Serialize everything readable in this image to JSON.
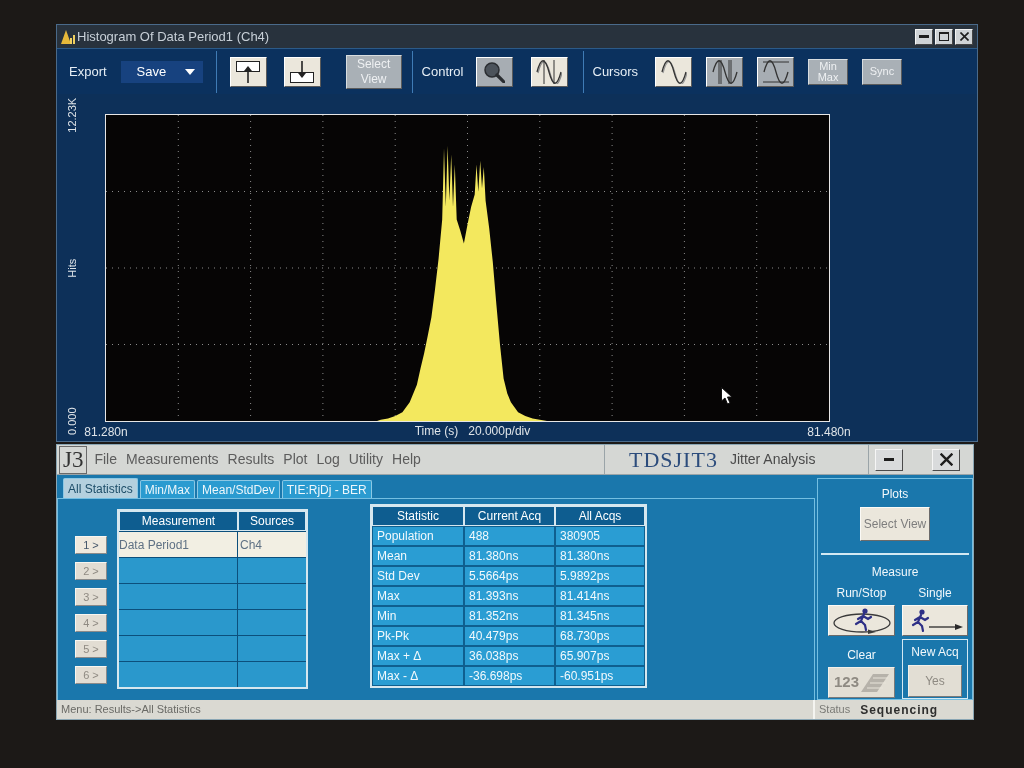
{
  "histogram_window": {
    "title": "Histogram Of Data Period1 (Ch4)",
    "toolbar": {
      "export": {
        "label": "Export",
        "dropdown": {
          "value": "Save"
        }
      },
      "file_buttons": [
        {
          "kind": "export"
        },
        {
          "kind": "import"
        }
      ],
      "select_view": {
        "label": "Select View",
        "disabled": true
      },
      "control": {
        "label": "Control",
        "buttons": [
          {
            "kind": "zoom",
            "pressed": true
          },
          {
            "kind": "waveform",
            "pressed": false
          }
        ]
      },
      "cursors": {
        "label": "Cursors",
        "buttons": [
          {
            "kind": "sine",
            "pressed": false
          },
          {
            "kind": "vertical",
            "pressed": true
          },
          {
            "kind": "horizontal",
            "pressed": true
          },
          {
            "kind": "text",
            "label": "Min Max",
            "disabled": true
          },
          {
            "kind": "text",
            "label": "Sync",
            "disabled": true
          }
        ]
      }
    },
    "chart": {
      "scale": "20.000p/div",
      "chart_data": {
        "type": "area",
        "xlabel": "Time (s)",
        "ylabel": "Hits",
        "x": [
          81.355,
          81.356,
          81.358,
          81.36,
          81.362,
          81.364,
          81.366,
          81.367,
          81.368,
          81.369,
          81.37,
          81.371,
          81.372,
          81.373,
          81.3735,
          81.374,
          81.3745,
          81.375,
          81.3755,
          81.376,
          81.3765,
          81.377,
          81.378,
          81.379,
          81.38,
          81.381,
          81.382,
          81.3825,
          81.383,
          81.3835,
          81.384,
          81.3845,
          81.385,
          81.386,
          81.387,
          81.388,
          81.389,
          81.39,
          81.391,
          81.392,
          81.394,
          81.396,
          81.398,
          81.4,
          81.402
        ],
        "series": [
          {
            "color": "#f3e85e",
            "values": [
              0,
              50,
              100,
              200,
              350,
              750,
              1450,
              2100,
              2700,
              3400,
              4150,
              5250,
              6500,
              8050,
              10900,
              8550,
              11000,
              8800,
              10650,
              8550,
              10250,
              8050,
              7600,
              7100,
              7850,
              8550,
              9050,
              10250,
              9150,
              10400,
              9300,
              10150,
              8800,
              7700,
              6350,
              4650,
              3050,
              1700,
              1100,
              750,
              350,
              200,
              100,
              50,
              0
            ]
          }
        ],
        "xlim": [
          81.28,
          81.48
        ],
        "ylim": [
          0,
          12230
        ],
        "xticks": [
          {
            "value": 81.28,
            "label": "81.280n"
          },
          {
            "value": 81.48,
            "label": "81.480n"
          }
        ],
        "yticks": [
          {
            "value": 0,
            "label": "0.000"
          },
          {
            "value": 12230,
            "label": "12.23K"
          }
        ]
      }
    }
  },
  "jitter_window": {
    "logo": "J3",
    "menu": [
      "File",
      "Measurements",
      "Results",
      "Plot",
      "Log",
      "Utility",
      "Help"
    ],
    "product": "TDSJIT3",
    "subtitle": "Jitter Analysis",
    "tabs": [
      {
        "label": "All Statistics",
        "selected": true
      },
      {
        "label": "Min/Max",
        "selected": false
      },
      {
        "label": "Mean/StdDev",
        "selected": false
      },
      {
        "label": "TIE:RjDj - BER",
        "selected": false
      }
    ],
    "measurements": {
      "columns": [
        "Measurement",
        "Sources"
      ],
      "rows": [
        {
          "button": "1 >",
          "disabled": false,
          "measurement": "Data Period1",
          "source": "Ch4",
          "selected": true
        },
        {
          "button": "2 >",
          "disabled": true,
          "selected": false
        },
        {
          "button": "3 >",
          "disabled": true,
          "selected": false
        },
        {
          "button": "4 >",
          "disabled": true,
          "selected": false
        },
        {
          "button": "5 >",
          "disabled": true,
          "selected": false
        },
        {
          "button": "6 >",
          "disabled": true,
          "selected": false
        }
      ]
    },
    "statistics": {
      "columns": [
        "Statistic",
        "Current Acq",
        "All Acqs"
      ],
      "rows": [
        [
          "Population",
          "488",
          "380905"
        ],
        [
          "Mean",
          "81.380ns",
          "81.380ns"
        ],
        [
          "Std Dev",
          "5.5664ps",
          "5.9892ps"
        ],
        [
          "Max",
          "81.393ns",
          "81.414ns"
        ],
        [
          "Min",
          "81.352ns",
          "81.345ns"
        ],
        [
          "Pk-Pk",
          "40.479ps",
          "68.730ps"
        ],
        [
          "Max + Δ",
          "36.038ps",
          "65.907ps"
        ],
        [
          "Max - Δ",
          "-36.698ps",
          "-60.951ps"
        ]
      ]
    },
    "plots": {
      "title": "Plots",
      "button": {
        "label": "Select View",
        "disabled": true
      }
    },
    "measure": {
      "title": "Measure",
      "run_stop": {
        "label": "Run/Stop"
      },
      "single": {
        "label": "Single"
      },
      "clear": {
        "label": "Clear",
        "button": "123",
        "disabled": true
      },
      "new_acq": {
        "label": "New Acq",
        "button": "Yes",
        "disabled": true
      }
    },
    "status_bar": {
      "message": "Menu: Results->All Statistics",
      "status_label": "Status",
      "status": "Sequencing"
    }
  }
}
